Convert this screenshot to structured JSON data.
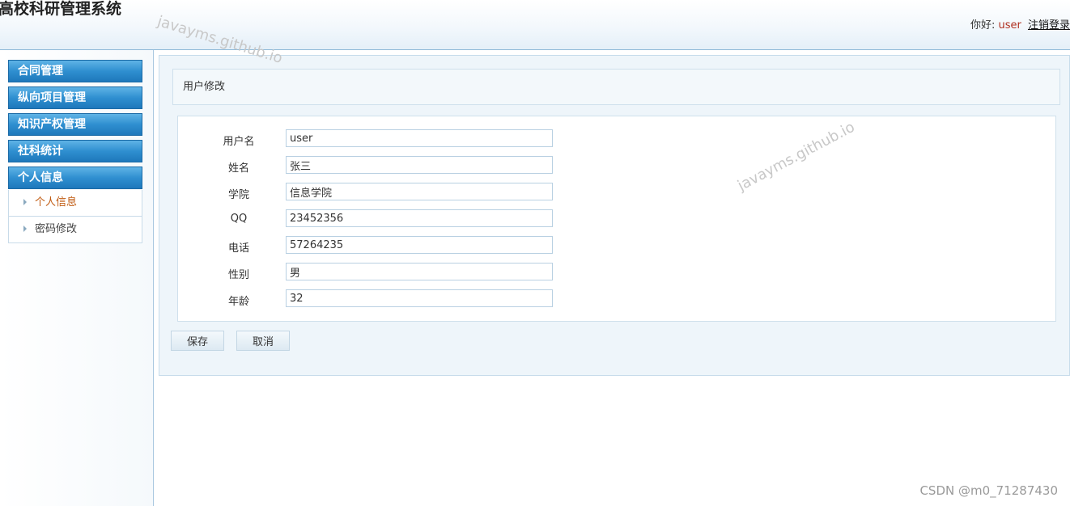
{
  "header": {
    "title": "高校科研管理系统",
    "greeting": "你好:",
    "username": "user",
    "logout_label": "注销登录"
  },
  "sidebar": {
    "menus": [
      {
        "label": "合同管理"
      },
      {
        "label": "纵向项目管理"
      },
      {
        "label": "知识产权管理"
      },
      {
        "label": "社科统计"
      },
      {
        "label": "个人信息"
      }
    ],
    "subitems": [
      {
        "label": "个人信息",
        "active": true
      },
      {
        "label": "密码修改",
        "active": false
      }
    ]
  },
  "main": {
    "section_title": "用户修改",
    "fields": [
      {
        "label": "用户名",
        "value": "user"
      },
      {
        "label": "姓名",
        "value": "张三"
      },
      {
        "label": "学院",
        "value": "信息学院"
      },
      {
        "label": "QQ",
        "value": "23452356"
      },
      {
        "label": "电话",
        "value": "57264235"
      },
      {
        "label": "性别",
        "value": "男"
      },
      {
        "label": "年龄",
        "value": "32"
      }
    ],
    "save_label": "保存",
    "cancel_label": "取消"
  },
  "watermark": {
    "text": "javayms.github.io"
  },
  "credit": {
    "text": "CSDN @m0_71287430"
  },
  "colors": {
    "accent": "#2f8fd0",
    "active_item": "#c05a10",
    "username": "#b03020"
  }
}
